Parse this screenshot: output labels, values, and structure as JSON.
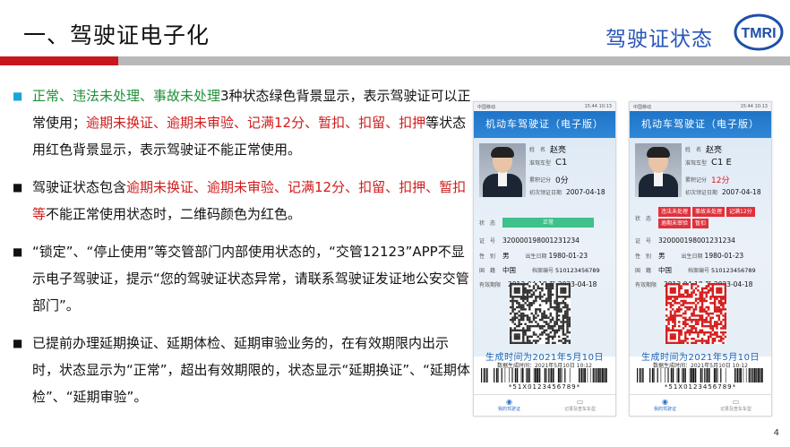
{
  "header": {
    "title": "一、驾驶证电子化",
    "subtitle": "驾驶证状态",
    "logo_text": "TMRI"
  },
  "bullets": [
    {
      "segments": [
        {
          "t": "正常、违法未处理、事故未处理",
          "c": "green"
        },
        {
          "t": "3种状态绿色背景显示，表示驾驶证可以正常使用；",
          "c": ""
        },
        {
          "t": "逾期未换证、逾期未审验、记满12分、暂扣、扣留、扣押",
          "c": "red"
        },
        {
          "t": "等状态用红色背景显示，表示驾驶证不能正常使用。",
          "c": ""
        }
      ]
    },
    {
      "segments": [
        {
          "t": "驾驶证状态包含",
          "c": ""
        },
        {
          "t": "逾期未换证、逾期未审验、记满12分、扣留、扣押、暂扣等",
          "c": "red"
        },
        {
          "t": "不能正常使用状态时，二维码颜色为红色。",
          "c": ""
        }
      ]
    },
    {
      "segments": [
        {
          "t": "“锁定”、“停止使用”等交管部门内部使用状态的，“交管12123”APP不显示电子驾驶证，提示“您的驾驶证状态异常，请联系驾驶证发证地公安交管部门”。",
          "c": ""
        }
      ]
    },
    {
      "segments": [
        {
          "t": "已提前办理延期换证、延期体检、延期审验业务的，在有效期限内出示时，状态显示为“正常”，超出有效期限的，状态显示“延期换证”、“延期体检”、“延期审验”。",
          "c": ""
        }
      ]
    }
  ],
  "page_number": "4",
  "phones": [
    {
      "signal": "中国移动",
      "time": "15:44 10:13",
      "card_title": "机动车驾驶证（电子版）",
      "labels": {
        "name": "姓　名",
        "class": "准驾车型",
        "score": "累积记分",
        "issue": "初次领证日期",
        "status": "状　态",
        "id": "证　号",
        "sex": "性　别",
        "birth": "出生日期",
        "country": "国　籍",
        "file": "档案编号",
        "valid": "有效期限"
      },
      "name": "赵亮",
      "vehicle_class": "C1",
      "score": "0分",
      "first_issue": "2007-04-18",
      "status_tags": [
        {
          "text": "正常",
          "color": "green"
        }
      ],
      "id_no": "320000198001231234",
      "sex": "男",
      "birth": "1980-01-23",
      "country": "中国",
      "file_no": "510123456789",
      "valid": "2013-04-18 至 2023-04-18",
      "qr_color": "#333333",
      "generated": "生成时间为2021年5月10日",
      "generated_sub": "数据生成时间：2021年5月10日 10:12",
      "barcode_number": "*51X0123456789*",
      "nav": [
        "我的驾驶证",
        "记录及查车车型"
      ]
    },
    {
      "signal": "中国移动",
      "time": "15:44 10:13",
      "card_title": "机动车驾驶证（电子版）",
      "labels": {
        "name": "姓　名",
        "class": "准驾车型",
        "score": "累积记分",
        "issue": "初次领证日期",
        "status": "状　态",
        "id": "证　号",
        "sex": "性　别",
        "birth": "出生日期",
        "country": "国　籍",
        "file": "档案编号",
        "valid": "有效期限"
      },
      "name": "赵亮",
      "vehicle_class": "C1 E",
      "score": "12分",
      "first_issue": "2007-04-18",
      "status_tags": [
        {
          "text": "违法未处理",
          "color": "red"
        },
        {
          "text": "事故未处理",
          "color": "red"
        },
        {
          "text": "记满12分",
          "color": "red"
        },
        {
          "text": "逾期未审验",
          "color": "red"
        },
        {
          "text": "暂扣",
          "color": "red"
        }
      ],
      "id_no": "320000198001231234",
      "sex": "男",
      "birth": "1980-01-23",
      "country": "中国",
      "file_no": "510123456789",
      "valid": "2013-04-18 至 2023-04-18",
      "qr_color": "#d41c1c",
      "generated": "生成时间为2021年5月10日",
      "generated_sub": "数据生成时间：2021年5月10日 10:12",
      "barcode_number": "*51X0123456789*",
      "nav": [
        "我的驾驶证",
        "记录及查车车型"
      ]
    }
  ]
}
